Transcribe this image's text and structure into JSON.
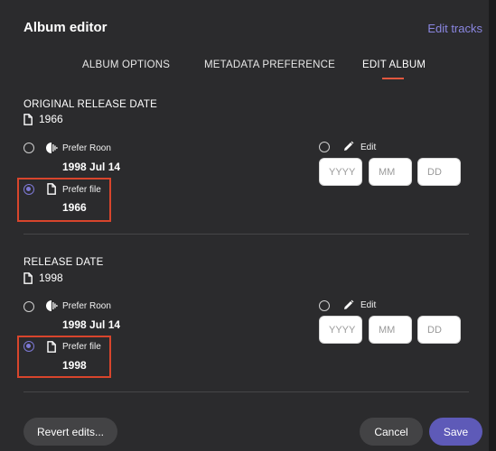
{
  "header": {
    "title": "Album editor",
    "edit_tracks": "Edit tracks"
  },
  "tabs": [
    {
      "label": "ALBUM OPTIONS",
      "active": false
    },
    {
      "label": "METADATA PREFERENCE",
      "active": false
    },
    {
      "label": "EDIT ALBUM",
      "active": true
    }
  ],
  "original_release": {
    "label": "ORIGINAL RELEASE DATE",
    "value": "1966",
    "prefer_roon_label": "Prefer Roon",
    "roon_value": "1998 Jul 14",
    "prefer_file_label": "Prefer file",
    "file_value": "1966",
    "edit_label": "Edit",
    "year_placeholder": "YYYY",
    "month_placeholder": "MM",
    "day_placeholder": "DD",
    "selected": "prefer_file"
  },
  "release": {
    "label": "RELEASE DATE",
    "value": "1998",
    "prefer_roon_label": "Prefer Roon",
    "roon_value": "1998 Jul 14",
    "prefer_file_label": "Prefer file",
    "file_value": "1998",
    "edit_label": "Edit",
    "year_placeholder": "YYYY",
    "month_placeholder": "MM",
    "day_placeholder": "DD",
    "selected": "prefer_file"
  },
  "footer": {
    "revert": "Revert edits...",
    "cancel": "Cancel",
    "save": "Save"
  },
  "colors": {
    "accent": "#5e5ab8",
    "highlight": "#d8452c",
    "link": "#8a86e0",
    "tab_underline": "#e2573f"
  }
}
